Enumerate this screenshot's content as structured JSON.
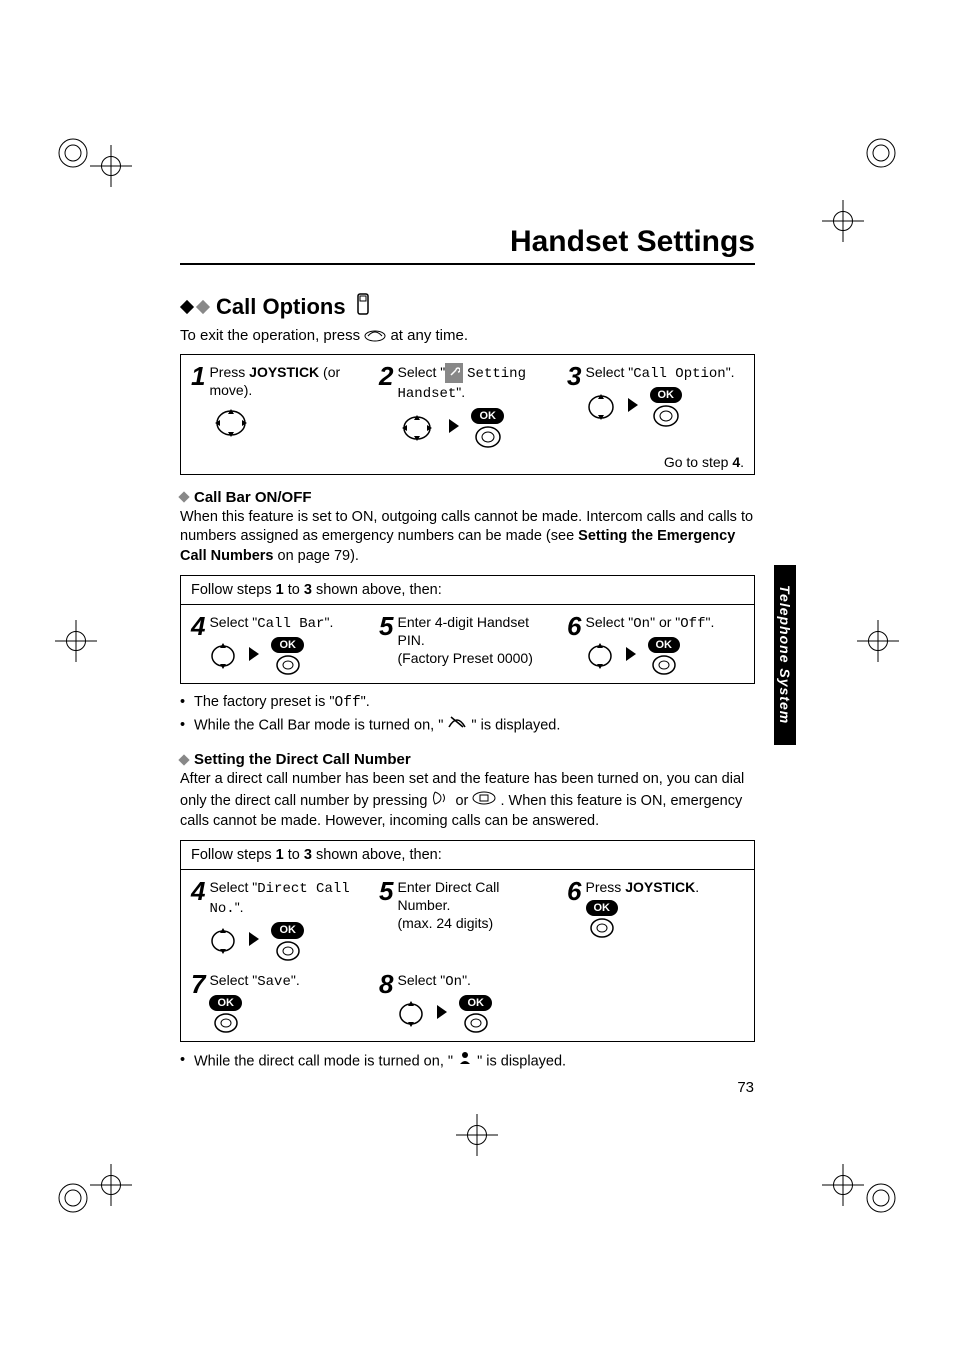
{
  "header": {
    "title": "Handset Settings"
  },
  "section": {
    "title": "Call Options",
    "exit_text_before": "To exit the operation, press ",
    "exit_text_after": " at any time."
  },
  "main_steps": {
    "s1": {
      "num": "1",
      "before": "Press ",
      "bold": "JOYSTICK",
      "after": " (or move)."
    },
    "s2": {
      "num": "2",
      "before": "Select \"",
      "icon_label": "Setting Handset",
      "after": "\"."
    },
    "s3": {
      "num": "3",
      "before": "Select \"",
      "mono": "Call Option",
      "after": "\"."
    },
    "goto_before": "Go to step ",
    "goto_bold": "4",
    "goto_after": "."
  },
  "callbar": {
    "heading": "Call Bar ON/OFF",
    "body_before": "When this feature is set to ON, outgoing calls cannot be made. Intercom calls and calls to numbers assigned as emergency numbers can be made (see ",
    "body_bold": "Setting the Emergency Call Numbers",
    "body_after": " on page 79).",
    "follow_before": "Follow steps ",
    "follow_b1": "1",
    "follow_mid": " to ",
    "follow_b3": "3",
    "follow_after": " shown above, then:",
    "s4": {
      "num": "4",
      "before": "Select \"",
      "mono": "Call Bar",
      "after": "\"."
    },
    "s5": {
      "num": "5",
      "line1": "Enter 4-digit Handset PIN.",
      "line2": "(Factory Preset 0000)"
    },
    "s6": {
      "num": "6",
      "before": "Select \"",
      "mono1": "On",
      "mid": "\" or \"",
      "mono2": "Off",
      "after": "\"."
    },
    "bullet1_before": "The factory preset is \"",
    "bullet1_mono": "Off",
    "bullet1_after": "\".",
    "bullet2_before": "While the Call Bar mode is turned on, \"",
    "bullet2_after": "\" is displayed."
  },
  "direct": {
    "heading": "Setting the Direct Call Number",
    "body": "After a direct call number has been set and the feature has been turned on, you can dial only the direct call number by pressing      or      . When this feature is ON, emergency calls cannot be made. However, incoming calls can be answered.",
    "follow_before": "Follow steps ",
    "follow_b1": "1",
    "follow_mid": " to ",
    "follow_b3": "3",
    "follow_after": " shown above, then:",
    "s4": {
      "num": "4",
      "before": "Select \"",
      "mono": "Direct Call No.",
      "after": "\"."
    },
    "s5": {
      "num": "5",
      "line1": "Enter Direct Call Number.",
      "line2": "(max. 24 digits)"
    },
    "s6": {
      "num": "6",
      "before": "Press ",
      "bold": "JOYSTICK",
      "after": "."
    },
    "s7": {
      "num": "7",
      "before": "Select \"",
      "mono": "Save",
      "after": "\"."
    },
    "s8": {
      "num": "8",
      "before": "Select \"",
      "mono": "On",
      "after": "\"."
    },
    "bullet_before": "While the direct call mode is turned on, \"",
    "bullet_after": "\" is displayed."
  },
  "side_tab": "Telephone System",
  "page_number": "73",
  "ok_label": "OK",
  "icons": {
    "phone_off": "phone-off-icon",
    "handset": "handset-icon",
    "joystick": "joystick-icon",
    "wrench": "wrench-icon",
    "barred": "barred-icon",
    "direct_dot": "direct-call-icon",
    "talk": "talk-icon",
    "speaker": "speaker-icon"
  }
}
